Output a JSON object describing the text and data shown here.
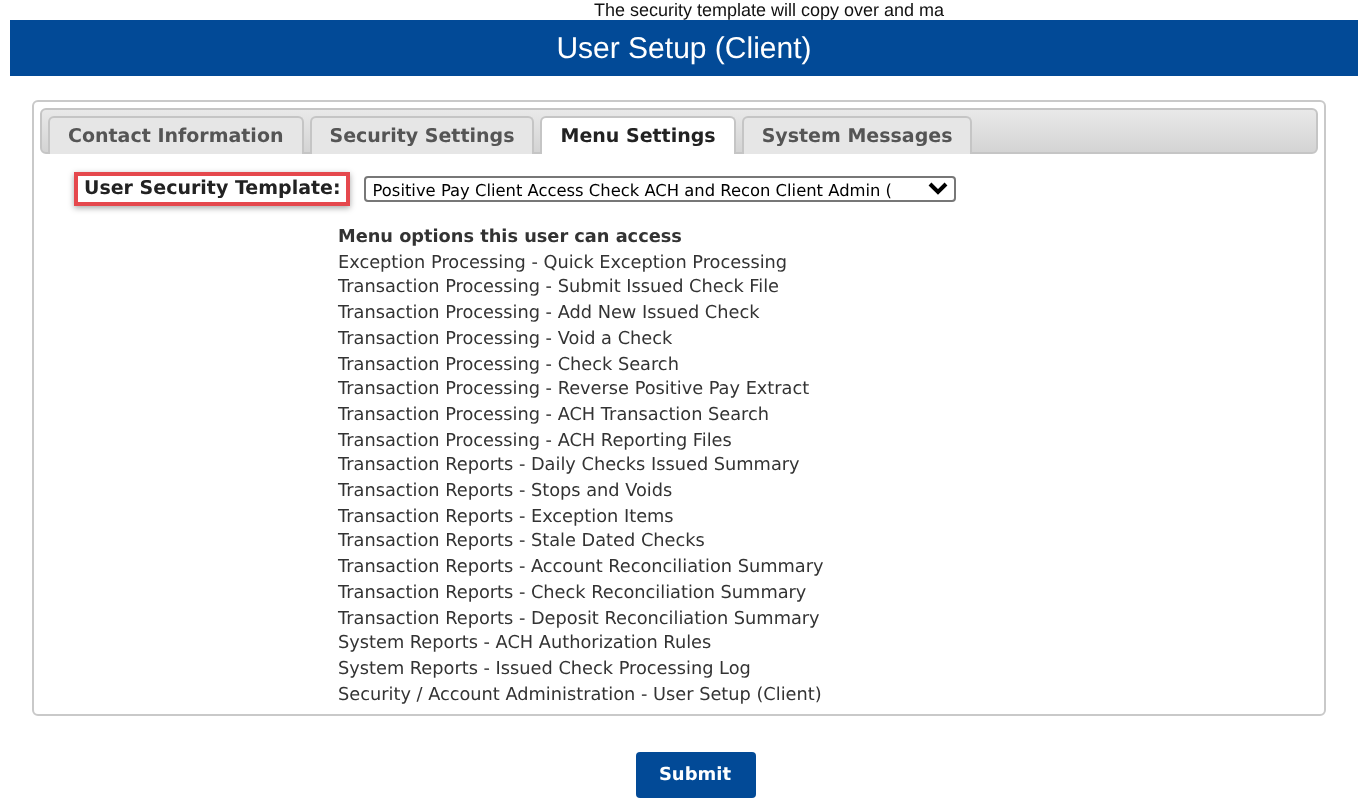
{
  "caption": "The security template will copy over and ma",
  "header": {
    "title": "User Setup (Client)"
  },
  "tabs": [
    {
      "label": "Contact Information",
      "selected": false
    },
    {
      "label": "Security Settings",
      "selected": false
    },
    {
      "label": "Menu Settings",
      "selected": true
    },
    {
      "label": "System Messages",
      "selected": false
    }
  ],
  "template": {
    "label": "User Security Template:",
    "value": "Positive Pay Client Access Check ACH and Recon Client Admin ("
  },
  "menu_options": {
    "heading": "Menu options this user can access",
    "items": [
      "Exception Processing - Quick Exception Processing",
      "Transaction Processing - Submit Issued Check File",
      "Transaction Processing - Add New Issued Check",
      "Transaction Processing - Void a Check",
      "Transaction Processing - Check Search",
      "Transaction Processing - Reverse Positive Pay Extract",
      "Transaction Processing - ACH Transaction Search",
      "Transaction Processing - ACH Reporting Files",
      "Transaction Reports - Daily Checks Issued Summary",
      "Transaction Reports - Stops and Voids",
      "Transaction Reports - Exception Items",
      "Transaction Reports - Stale Dated Checks",
      "Transaction Reports - Account Reconciliation Summary",
      "Transaction Reports - Check Reconciliation Summary",
      "Transaction Reports - Deposit Reconciliation Summary",
      "System Reports - ACH Authorization Rules",
      "System Reports - Issued Check Processing Log",
      "Security / Account Administration - User Setup (Client)"
    ]
  },
  "submit": "Submit"
}
